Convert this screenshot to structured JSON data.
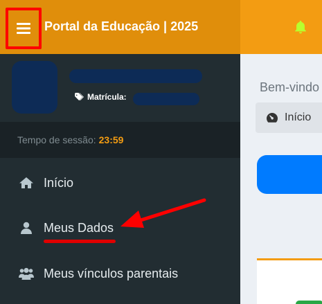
{
  "header": {
    "title": "Portal da Educação | 2025",
    "menu_icon": "hamburger-icon",
    "notification_icon": "bell-icon",
    "brand_color": "#e08e0b",
    "topbar_color": "#f39c12"
  },
  "user": {
    "matricula_label": "Matrícula:"
  },
  "session": {
    "label": "Tempo de sessão:",
    "time": "23:59"
  },
  "sidebar": {
    "items": [
      {
        "label": "Início",
        "icon": "home-icon"
      },
      {
        "label": "Meus Dados",
        "icon": "user-icon"
      },
      {
        "label": "Meus vínculos parentais",
        "icon": "users-icon"
      }
    ]
  },
  "main": {
    "welcome": "Bem-vindo",
    "breadcrumb": {
      "label": "Início",
      "icon": "dashboard-icon"
    }
  },
  "annotation": {
    "color": "#ff0000"
  }
}
